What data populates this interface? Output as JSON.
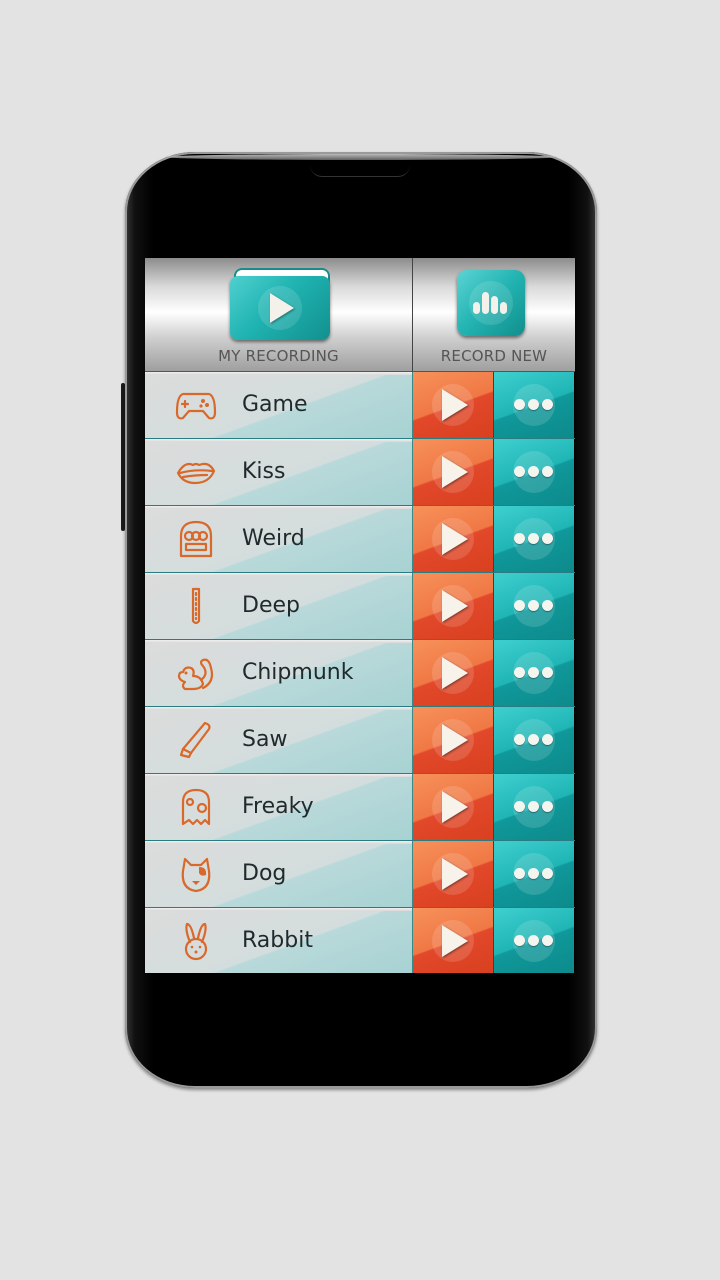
{
  "header": {
    "my_recording_label": "MY RECORDING",
    "record_new_label": "RECORD NEW",
    "my_recording_icon": "folder-play-icon",
    "record_new_icon": "sound-bars-icon"
  },
  "effects": [
    {
      "label": "Game",
      "icon": "gamepad-icon"
    },
    {
      "label": "Kiss",
      "icon": "lips-icon"
    },
    {
      "label": "Weird",
      "icon": "robot-icon"
    },
    {
      "label": "Deep",
      "icon": "tube-icon"
    },
    {
      "label": "Chipmunk",
      "icon": "squirrel-icon"
    },
    {
      "label": "Saw",
      "icon": "saw-icon"
    },
    {
      "label": "Freaky",
      "icon": "ghost-icon"
    },
    {
      "label": "Dog",
      "icon": "dog-icon"
    },
    {
      "label": "Rabbit",
      "icon": "rabbit-icon"
    }
  ],
  "row_actions": {
    "play_icon": "play-icon",
    "more_icon": "more-dots-icon"
  },
  "colors": {
    "teal": "#1fb3b1",
    "orange": "#f07845",
    "icon_orange": "#d9692a"
  }
}
